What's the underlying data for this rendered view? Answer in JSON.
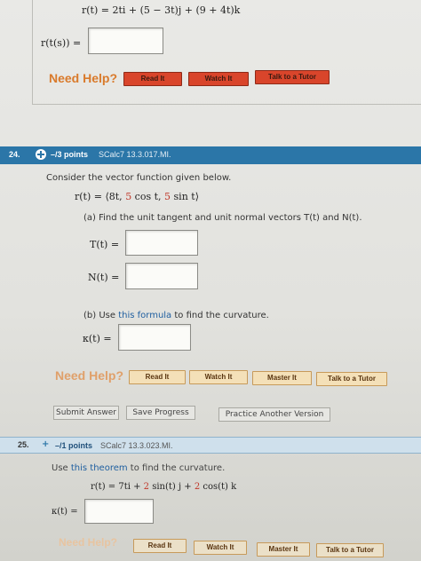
{
  "q23": {
    "r_of_t": "r(t) = 2ti + (5 − 3t)j + (9 + 4t)k",
    "r_of_t_of_s": "r(t(s)) =",
    "need_help": "Need Help?",
    "buttons": [
      "Read It",
      "Watch It",
      "Talk to a Tutor"
    ]
  },
  "q24": {
    "number": "24.",
    "points": "–/3 points",
    "source": "SCalc7 13.3.017.MI.",
    "intro": "Consider the vector function given below.",
    "r_prefix": "r(t) = ⟨8t, ",
    "r_red1": "5",
    "r_mid": " cos t, ",
    "r_red2": "5",
    "r_suffix": " sin t⟩",
    "part_a": "(a) Find the unit tangent and unit normal vectors T(t) and N(t).",
    "T_label": "T(t) =",
    "N_label": "N(t) =",
    "part_b_prefix": "(b) Use ",
    "part_b_link": "this formula",
    "part_b_suffix": " to find the curvature.",
    "kappa_label": "κ(t) =",
    "need_help": "Need Help?",
    "buttons": [
      "Read It",
      "Watch It",
      "Master It",
      "Talk to a Tutor"
    ],
    "actions": [
      "Submit Answer",
      "Save Progress",
      "Practice Another Version"
    ]
  },
  "q25": {
    "number": "25.",
    "points": "–/1 points",
    "source": "SCalc7 13.3.023.MI.",
    "intro_prefix": "Use ",
    "intro_link": "this theorem",
    "intro_suffix": " to find the curvature.",
    "r_prefix": "r(t) = 7ti + ",
    "r_red1": "2",
    "r_mid": " sin(t) j + ",
    "r_red2": "2",
    "r_suffix": " cos(t) k",
    "kappa_label": "κ(t) =",
    "need_help": "Need Help?",
    "buttons": [
      "Read It",
      "Watch It",
      "Master It",
      "Talk to a Tutor"
    ]
  },
  "colors": {
    "question_bar": "#2b76a8",
    "question_bar_light": "#cfe0ec",
    "need_help": "#d97a2b",
    "button_red": "#d9452b",
    "button_cream": "#f4e0b8",
    "red_value": "#c0392b"
  }
}
